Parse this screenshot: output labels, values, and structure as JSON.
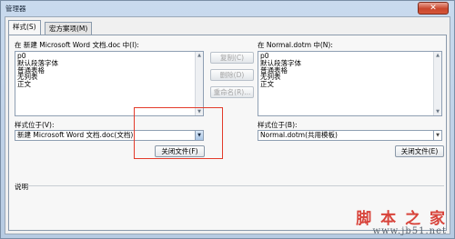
{
  "window": {
    "title": "管理器",
    "close_glyph": "✕"
  },
  "tabs": [
    {
      "label": "样式(S)",
      "active": true
    },
    {
      "label": "宏方案项(M)",
      "active": false
    }
  ],
  "left": {
    "list_label": "在 新建 Microsoft Word 文档.doc 中(I):",
    "items": [
      "p0",
      "默认段落字体",
      "普通表格",
      "无列表",
      "正文"
    ],
    "location_label": "样式位于(V):",
    "location_value": "新建 Microsoft Word 文档.doc(文档)",
    "close_file_button": "关闭文件(F)"
  },
  "middle": {
    "copy_button": "复制(C)",
    "delete_button": "删除(D)",
    "rename_button": "重命名(R)..."
  },
  "right": {
    "list_label": "在 Normal.dotm 中(N):",
    "items": [
      "p0",
      "默认段落字体",
      "普通表格",
      "无列表",
      "正文"
    ],
    "location_label": "样式位于(B):",
    "location_value": "Normal.dotm(共用模板)",
    "close_file_button": "关闭文件(E)"
  },
  "description": {
    "label": "说明"
  },
  "watermark": {
    "brand": "脚 本 之 家",
    "site": "www.jb51.net"
  },
  "colors": {
    "highlight_box": "#e33b2b",
    "close_button": "#c9462c",
    "watermark": "#d8443b"
  }
}
